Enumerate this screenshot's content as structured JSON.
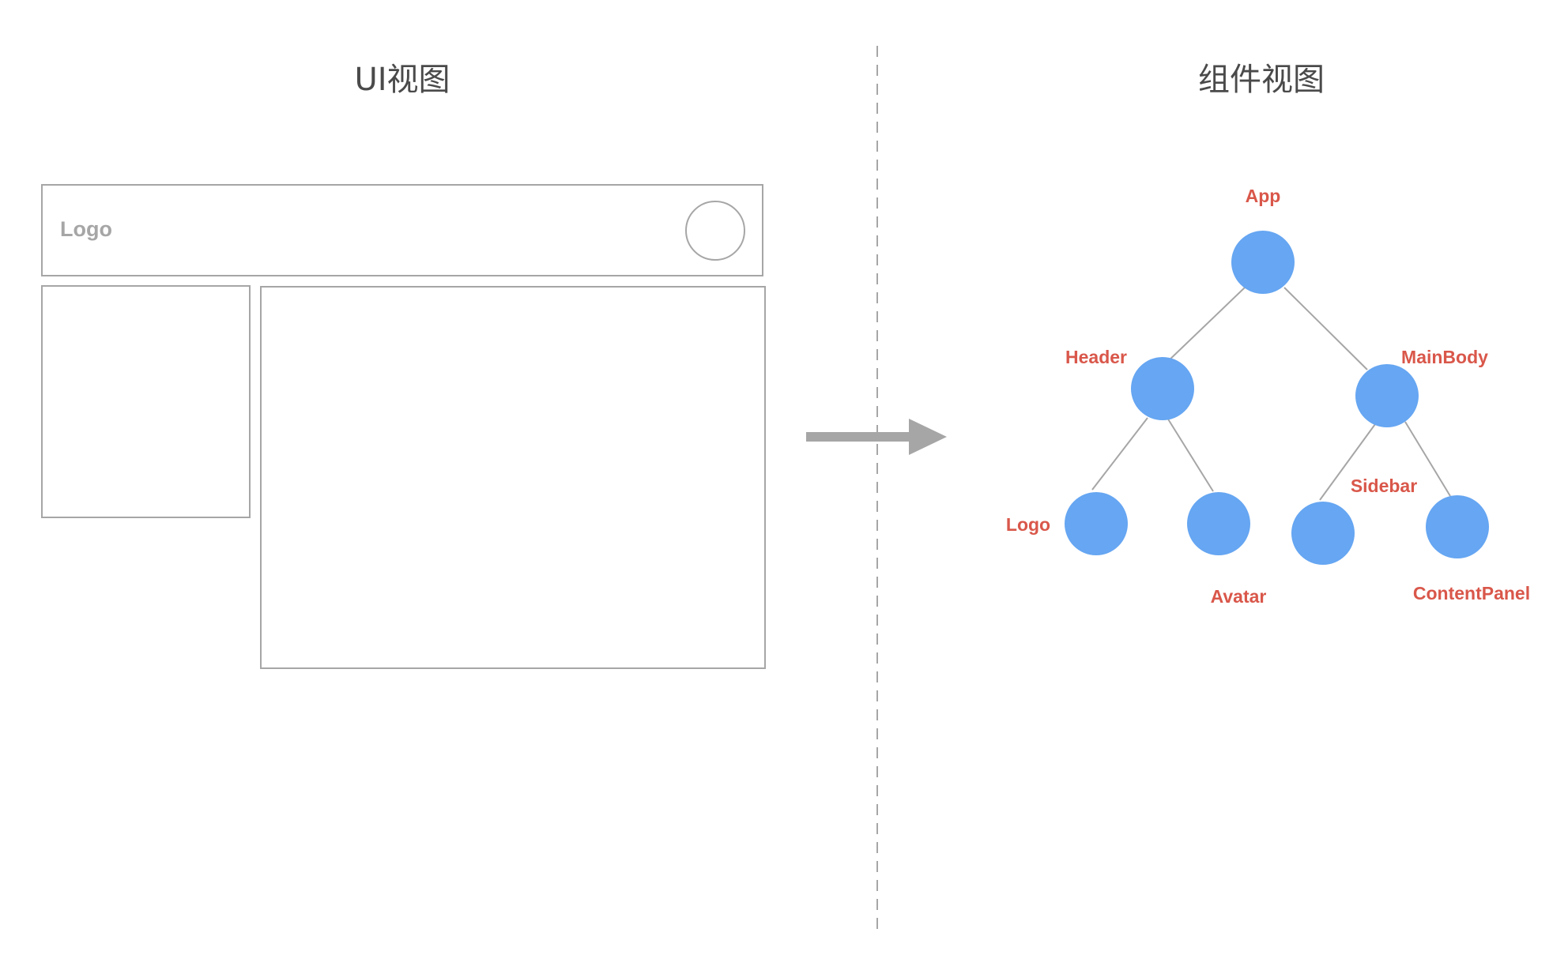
{
  "ui_view": {
    "title": "UI视图",
    "header_logo_label": "Logo"
  },
  "component_view": {
    "title": "组件视图"
  },
  "tree": {
    "node_color": "#66a6f2",
    "label_color": "#d9574a",
    "nodes": {
      "app": "App",
      "header": "Header",
      "mainbody": "MainBody",
      "logo": "Logo",
      "avatar": "Avatar",
      "sidebar": "Sidebar",
      "contentpanel": "ContentPanel"
    }
  },
  "colors": {
    "wireframe_stroke": "#a6a6a6",
    "arrow": "#a6a6a6",
    "divider": "#a6a6a6"
  }
}
